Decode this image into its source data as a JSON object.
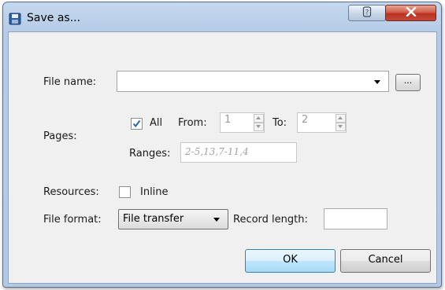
{
  "window": {
    "title": "Save as...",
    "help_glyph": "?",
    "close_glyph": "✕"
  },
  "form": {
    "file_name_label": "File name:",
    "file_name_value": "",
    "browse_label": "...",
    "pages_label": "Pages:",
    "all_label": "All",
    "all_checked": true,
    "from_label": "From:",
    "from_value": "1",
    "to_label": "To:",
    "to_value": "2",
    "ranges_label": "Ranges:",
    "ranges_placeholder": "2-5,13,7-11,4",
    "resources_label": "Resources:",
    "inline_label": "Inline",
    "inline_checked": false,
    "file_format_label": "File format:",
    "file_format_value": "File transfer",
    "record_length_label": "Record length:",
    "record_length_value": ""
  },
  "buttons": {
    "ok": "OK",
    "cancel": "Cancel"
  },
  "colors": {
    "titlebar": "#b5cbe6",
    "close": "#c2483a",
    "ok_border": "#3c7fb1",
    "check": "#2f63b5"
  },
  "icons": {
    "title": "floppy-disk-icon",
    "help": "help-icon",
    "close": "close-icon",
    "dropdown": "chevron-down-icon"
  }
}
